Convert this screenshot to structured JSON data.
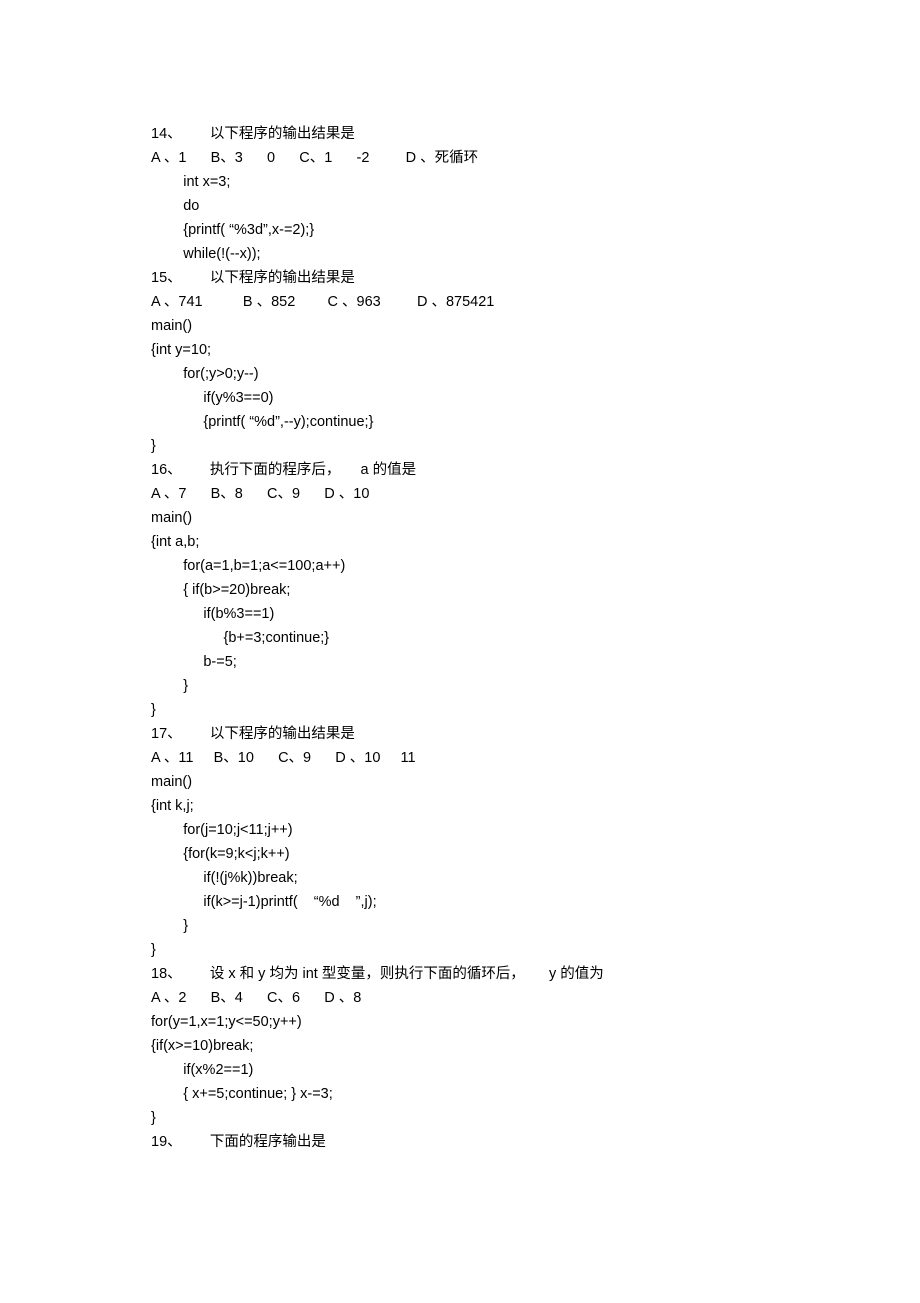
{
  "content": {
    "lines": [
      "14、       以下程序的输出结果是",
      "A 、1      B、3      0      C、1      -2         D 、死循环",
      "        int x=3;",
      "        do",
      "        {printf( “%3d”,x-=2);}",
      "        while(!(--x));",
      "15、       以下程序的输出结果是",
      "A 、741          B 、852        C 、963         D 、875421",
      "main()",
      "{int y=10;",
      "        for(;y>0;y--)",
      "             if(y%3==0)",
      "             {printf( “%d”,--y);continue;}",
      "}",
      "16、       执行下面的程序后，     a 的值是",
      "A 、7      B、8      C、9      D 、10",
      "main()",
      "{int a,b;",
      "        for(a=1,b=1;a<=100;a++)",
      "        { if(b>=20)break;",
      "             if(b%3==1)",
      "                  {b+=3;continue;}",
      "             b-=5;",
      "        }",
      "}",
      "17、       以下程序的输出结果是",
      "A 、11     B、10      C、9      D 、10     11",
      "main()",
      "{int k,j;",
      "        for(j=10;j<11;j++)",
      "        {for(k=9;k<j;k++)",
      "             if(!(j%k))break;",
      "             if(k>=j-1)printf(    “%d    ”,j);",
      "        }",
      "}",
      "18、       设 x 和 y 均为 int 型变量，则执行下面的循环后，      y 的值为",
      "A 、2      B、4      C、6      D 、8",
      "for(y=1,x=1;y<=50;y++)",
      "{if(x>=10)break;",
      "        if(x%2==1)",
      "        { x+=5;continue; } x-=3;",
      "",
      "}",
      "19、       下面的程序输出是"
    ]
  }
}
